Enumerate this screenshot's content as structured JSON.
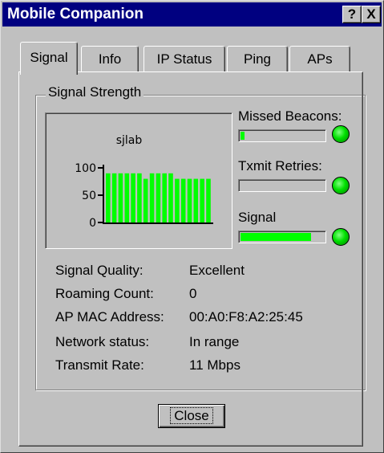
{
  "window": {
    "title": "Mobile Companion",
    "help_glyph": "?",
    "close_glyph": "X"
  },
  "tabs": [
    {
      "label": "Signal",
      "active": true
    },
    {
      "label": "Info",
      "active": false
    },
    {
      "label": "IP Status",
      "active": false
    },
    {
      "label": "Ping",
      "active": false
    },
    {
      "label": "APs",
      "active": false
    }
  ],
  "signal_group": {
    "label": "Signal Strength"
  },
  "chart_data": {
    "type": "bar",
    "title": "sjlab",
    "xlabel": "",
    "ylabel": "",
    "ylim": [
      0,
      100
    ],
    "yticks": [
      "100",
      "50",
      "0"
    ],
    "ytick_values": [
      100,
      50,
      0
    ],
    "values": [
      90,
      90,
      90,
      90,
      90,
      90,
      80,
      90,
      90,
      90,
      90,
      80,
      80,
      80,
      80,
      80,
      80
    ],
    "bar_color": "#00ff00",
    "axis_color": "#000000"
  },
  "meters": {
    "missed_beacons": {
      "label": "Missed Beacons:",
      "level": 0.05,
      "led_color": "#00e000"
    },
    "txmit_retries": {
      "label": "Txmit Retries:",
      "level": 0,
      "led_color": "#00e000"
    },
    "signal": {
      "label": "Signal",
      "level": 0.85,
      "led_color": "#00e000"
    }
  },
  "info": {
    "signal_quality": {
      "label": "Signal Quality:",
      "value": "Excellent"
    },
    "roaming_count": {
      "label": "Roaming Count:",
      "value": "0"
    },
    "ap_mac": {
      "label": "AP MAC Address:",
      "value": "00:A0:F8:A2:25:45"
    },
    "network_status": {
      "label": "Network status:",
      "value": "In range"
    },
    "transmit_rate": {
      "label": "Transmit Rate:",
      "value": "11 Mbps"
    }
  },
  "buttons": {
    "close": "Close"
  }
}
